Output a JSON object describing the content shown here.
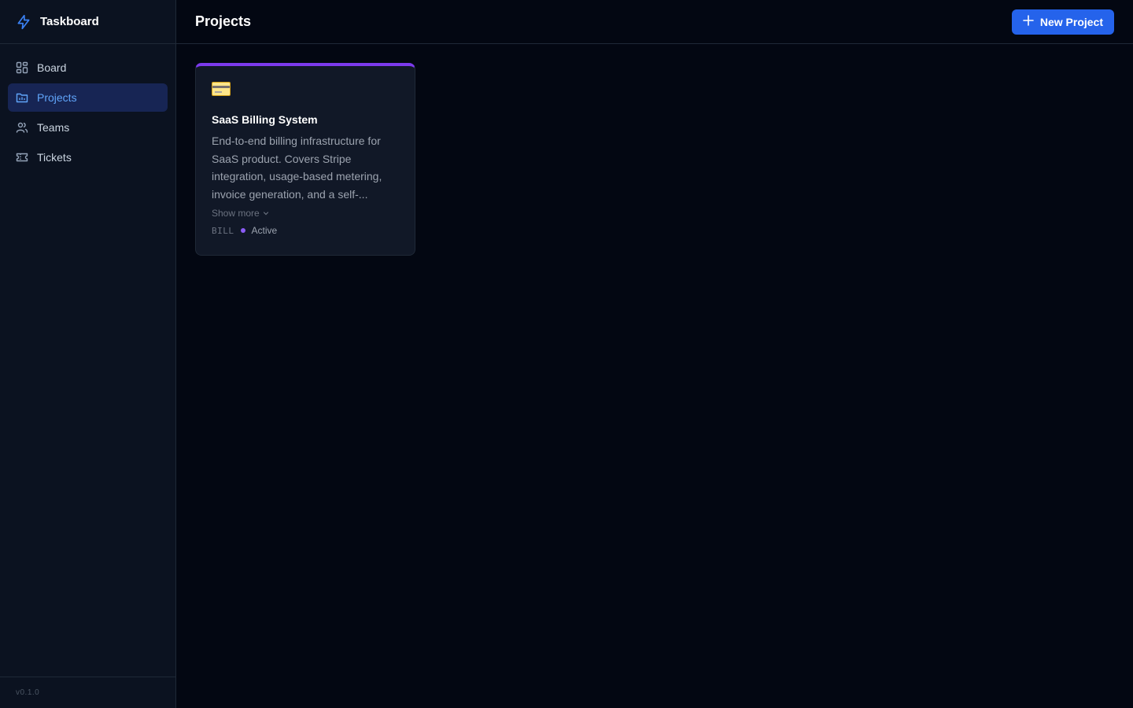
{
  "app": {
    "name": "Taskboard",
    "version": "v0.1.0"
  },
  "sidebar": {
    "items": [
      {
        "label": "Board",
        "icon": "grid-icon",
        "active": false
      },
      {
        "label": "Projects",
        "icon": "folder-icon",
        "active": true
      },
      {
        "label": "Teams",
        "icon": "users-icon",
        "active": false
      },
      {
        "label": "Tickets",
        "icon": "ticket-icon",
        "active": false
      }
    ]
  },
  "header": {
    "title": "Projects",
    "new_project_label": "New Project"
  },
  "projects": [
    {
      "icon": "credit-card-icon",
      "title": "SaaS Billing System",
      "description": "End-to-end billing infrastructure for SaaS product. Covers Stripe integration, usage-based metering, invoice generation, and a self-...",
      "show_more_label": "Show more",
      "key": "BILL",
      "status": "Active",
      "accent_color": "#7c3aed"
    }
  ],
  "colors": {
    "accent": "#2563eb",
    "background": "#030712",
    "sidebar": "#0b1220",
    "active_nav_bg": "#172554",
    "active_nav_text": "#60a5fa"
  }
}
